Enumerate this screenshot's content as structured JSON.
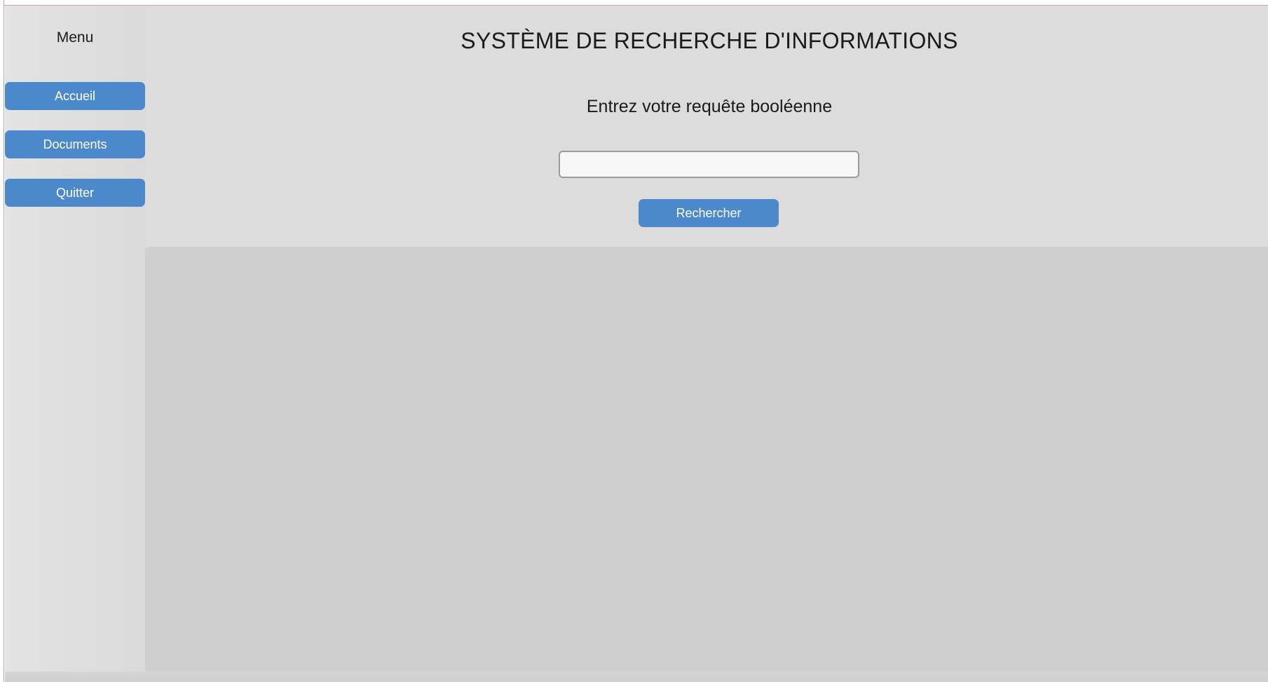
{
  "sidebar": {
    "title": "Menu",
    "items": [
      {
        "label": "Accueil"
      },
      {
        "label": "Documents"
      },
      {
        "label": "Quitter"
      }
    ]
  },
  "main": {
    "title": "SYSTÈME DE RECHERCHE D'INFORMATIONS",
    "query_label": "Entrez votre requête booléenne",
    "query_input": {
      "value": "",
      "placeholder": ""
    },
    "search_button": "Rechercher"
  },
  "colors": {
    "accent": "#4b88cc",
    "background": "#dcdcdc",
    "results_panel": "#cfcfcf"
  }
}
